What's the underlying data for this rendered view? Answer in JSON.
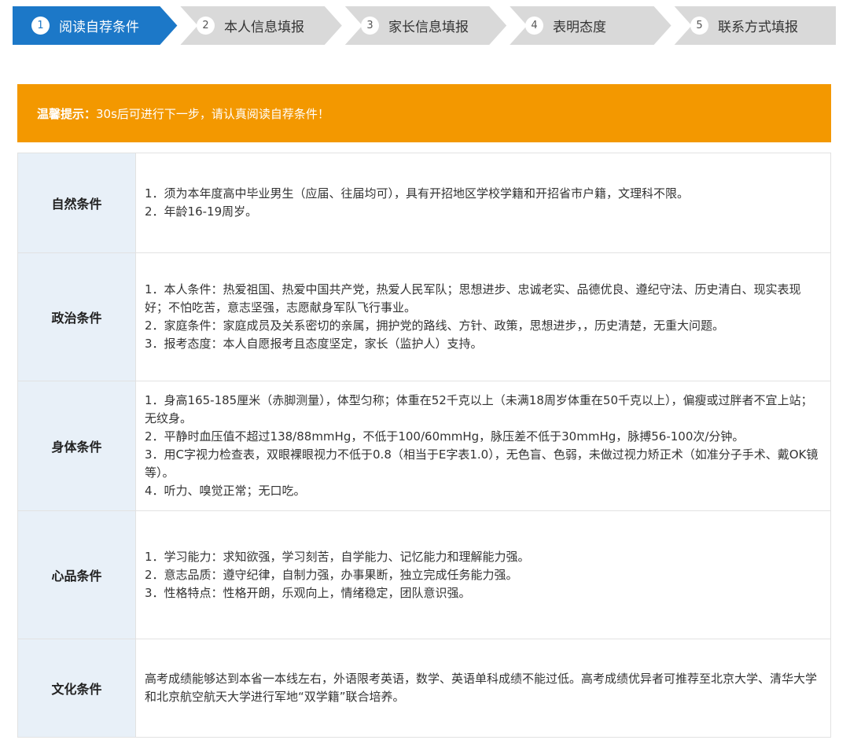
{
  "stepper": {
    "steps": [
      {
        "number": "1",
        "label": "阅读自荐条件"
      },
      {
        "number": "2",
        "label": "本人信息填报"
      },
      {
        "number": "3",
        "label": "家长信息填报"
      },
      {
        "number": "4",
        "label": "表明态度"
      },
      {
        "number": "5",
        "label": "联系方式填报"
      }
    ],
    "active_index": 0,
    "colors": {
      "active": "#1c78c8",
      "inactive": "#d9d9d9",
      "separator": "#ffffff"
    }
  },
  "notice": {
    "prefix": "温馨提示：",
    "text": "30s后可进行下一步，请认真阅读自荐条件！",
    "background": "#f39800"
  },
  "conditions": [
    {
      "label": "自然条件",
      "lines": [
        "1．须为本年度高中毕业男生（应届、往届均可），具有开招地区学校学籍和开招省市户籍，文理科不限。",
        "2．年龄16-19周岁。"
      ]
    },
    {
      "label": "政治条件",
      "lines": [
        "1．本人条件：热爱祖国、热爱中国共产党，热爱人民军队；思想进步、忠诚老实、品德优良、遵纪守法、历史清白、现实表现好；不怕吃苦，意志坚强，志愿献身军队飞行事业。",
        "2．家庭条件：家庭成员及关系密切的亲属，拥护党的路线、方针、政策，思想进步，，历史清楚，无重大问题。",
        "3．报考态度：本人自愿报考且态度坚定，家长（监护人）支持。"
      ]
    },
    {
      "label": "身体条件",
      "lines": [
        "1．身高165-185厘米（赤脚测量），体型匀称；体重在52千克以上（未满18周岁体重在50千克以上），偏瘦或过胖者不宜上站；无纹身。",
        "2．平静时血压值不超过138/88mmHg，不低于100/60mmHg，脉压差不低于30mmHg，脉搏56-100次/分钟。",
        "3．用C字视力检查表，双眼裸眼视力不低于0.8（相当于E字表1.0），无色盲、色弱，未做过视力矫正术（如准分子手术、戴OK镜等）。",
        "4．听力、嗅觉正常；无口吃。"
      ]
    },
    {
      "label": "心品条件",
      "lines": [
        "1．学习能力：求知欲强，学习刻苦，自学能力、记忆能力和理解能力强。",
        "2．意志品质：遵守纪律，自制力强，办事果断，独立完成任务能力强。",
        "3．性格特点：性格开朗，乐观向上，情绪稳定，团队意识强。"
      ]
    },
    {
      "label": "文化条件",
      "lines": [
        "高考成绩能够达到本省一本线左右，外语限考英语，数学、英语单科成绩不能过低。高考成绩优异者可推荐至北京大学、清华大学和北京航空航天大学进行军地“双学籍”联合培养。"
      ]
    }
  ]
}
